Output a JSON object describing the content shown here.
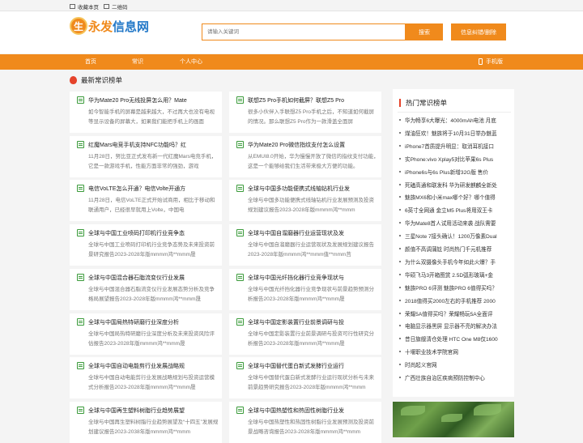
{
  "topbar": {
    "favorite": "收藏本页",
    "qrcode": "二维码"
  },
  "logo": {
    "mark": "生",
    "text_a": "永发",
    "text_b": "信息网"
  },
  "search": {
    "placeholder": "请输入关键词",
    "button": "搜索"
  },
  "feedback_button": "信息纠错/删除",
  "nav": {
    "items": [
      "首页",
      "常识",
      "个人中心"
    ],
    "mobile": "手机版"
  },
  "section_title": "最新常识榜单",
  "cards": [
    {
      "title": "华为Mate20 Pro无线投屏怎么用？Mate",
      "desc": "如今智能手机的屏幕是越来越大，不过再大也没有电视等显示设备的屏幕大，如果我们能把手机上的画面"
    },
    {
      "title": "联想Z5 Pro手机如何截屏？联想Z5 Pro",
      "desc": "很多小伙伴入手联想Z5 Pro手机之后，不知道如何截屏的情况。那么联想Z5 Pro作为一款滑盖全面屏"
    },
    {
      "title": "红魔Mars电竞手机支持NFC功能吗？红",
      "desc": "11月28日，努比亚正式发布新一代红魔Mars电竞手机，它是一款游戏手机，性能方面非常的强劲，游戏"
    },
    {
      "title": "华为Mate20 Pro微信指纹支付怎么设置",
      "desc": "从EMUI8.0开始，华为慢慢开放了微信的指纹支付功能，这是一个能够给我们生活带来极大方便的功能。"
    },
    {
      "title": "电信VoLTE怎么开通？电信Volte开通方",
      "desc": "11月28日，电信VoLTE正式开始试商用，相比于移动和联通用户，已经很早就用上Volte，中国电"
    },
    {
      "title": "全球与中国多功能便携式线轴钻机行业发",
      "desc": "全球与中国多功能便携式线轴钻机行业发展预测及投资规划建议报告2023-2028年版mmmm鸿**mmm"
    },
    {
      "title": "全球与中国工业喷码打印机行业竞争态",
      "desc": "全球与中国工业喷码打印机行业竞争态势及未来投资前景研究报告2023-2028年版mmmm鸿**mmm晟"
    },
    {
      "title": "全球与中国自溜磨器行业运营现状及发",
      "desc": "全球与中国自溜磨器行业运营现状及发展规划建议报告2023-2028年版mmmm鸿**mmm值**mmm莒"
    },
    {
      "title": "全球与中国混合器石脂流变仪行业发展",
      "desc": "全球与中国混合器石脂流变仪行业发展态势分析及竞争格局展望报告2023-2028年版mmmm鸿**mmm晟"
    },
    {
      "title": "全球与中国光纤挡化器行业竞争现状与",
      "desc": "全球与中国光纤挡化器行业竞争现状与前景趋势预测分析报告2023-2028年版mmmm鸿**mmm晟"
    },
    {
      "title": "全球与中国局热特研磨行业深度分析",
      "desc": "全球与中国局热特研磨行业深度分析及未来投资风险评估报告2023-2028年版mmmm鸿**mmm晟"
    },
    {
      "title": "全球与中国定影装置行业前景调研与投",
      "desc": "全球与中国定影装置行业前景调研与投资可行性研究分析报告2023-2028年版mmmm鸿**mmm晟"
    },
    {
      "title": "全球与中国自动电能剪行业发展战略规",
      "desc": "全球与中国自动电能剪行业发展战略规划与投资运营模式分析报告2023-2028年版mmmm鸿**mmm晟"
    },
    {
      "title": "全球与中国替代蛋白新式发酵行业运行",
      "desc": "全球与中国替代蛋白新式发酵行业运行现状分析与未来前景趋势研究报告2023-2028年版mmmm鸿**mmm"
    },
    {
      "title": "全球与中国再生塑料树脂行业趋势展望",
      "desc": "全球与中国再生塑料树脂行业趋势展望及“十四五”发展规划建议报告2023-2038年版mmmm鸿**mmm"
    },
    {
      "title": "全球与中国热塑性和热固性树脂行业发",
      "desc": "全球与中国热塑性和热固性树脂行业发展预测及投资前景战略咨询报告2023-2028年版mmmm鸿**mmm"
    }
  ],
  "sidebar": {
    "title": "热门常识榜单",
    "items": [
      "华为畅享6大曝光：4000mAh电池 月底",
      "煤油狂欢！魅族将于10月31日举办魅蓝",
      "iPhone7首质提升明显：取消耳机接口",
      "实Phone:vivo Xplay5对比苹果6s Plus",
      "iPhone6s与6s Plus新增32G版 售价",
      "死磕高通和联发科 华为研发麒麟全新处",
      "魅族MX6和小米max哪个好？哪个值得",
      "6英寸全网通 金立M5 Plus将用双王卡",
      "华为Mate8首人试用活动来袭 战队需要",
      "三星Note 7接头确认！1200万像素Dual",
      "颜值不高调蒲尬 时尚热门千元机推荐",
      "为什么双摄像头手机今年如此火爆？手",
      "华硕飞马3开箱图赏 2.5D弧形玻璃+金",
      "魅族PRO 6评测 魅族PRO 6值得买吗？",
      "2018值得买2000左右的手机推荐 2000",
      "荣耀5A值得买吗？荣耀畅玩5A全面评",
      "电脑显示器黑屏 显示器不亮的解决办法",
      "昔日旗舰清仓处理 HTC One M8仅1600",
      "十堰职业技术学院官网",
      "时尚起义官网",
      "广西壮族自治区疾病预防控制中心"
    ]
  }
}
